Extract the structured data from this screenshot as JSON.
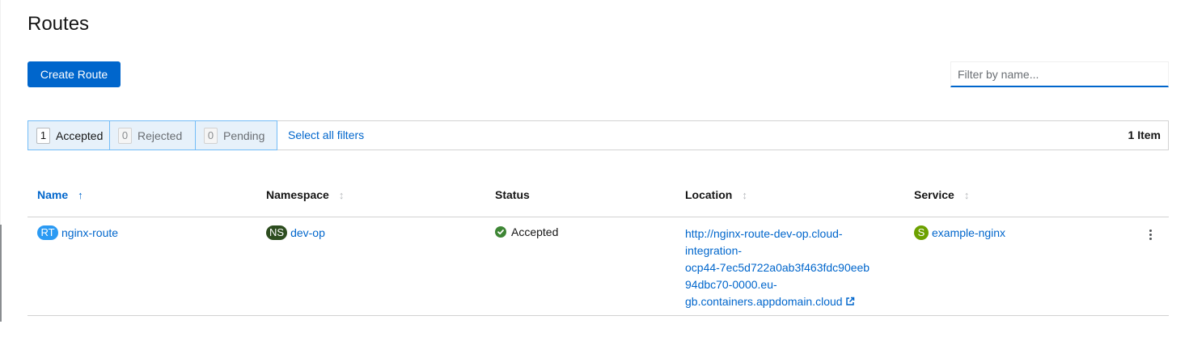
{
  "page": {
    "title": "Routes",
    "create_button_label": "Create Route"
  },
  "search": {
    "placeholder": "Filter by name...",
    "value": ""
  },
  "filters": {
    "row_filters": [
      {
        "count": "1",
        "label": "Accepted",
        "active": true
      },
      {
        "count": "0",
        "label": "Rejected",
        "active": false
      },
      {
        "count": "0",
        "label": "Pending",
        "active": false
      }
    ],
    "select_all_label": "Select all filters",
    "item_count_label": "1 Item"
  },
  "table": {
    "columns": [
      {
        "label": "Name",
        "sorted": true,
        "sort_icon": "arrow-up-icon"
      },
      {
        "label": "Namespace",
        "sorted": false,
        "sort_icon": "sort-icon"
      },
      {
        "label": "Status",
        "sorted": false
      },
      {
        "label": "Location",
        "sorted": false,
        "sort_icon": "sort-icon"
      },
      {
        "label": "Service",
        "sorted": false,
        "sort_icon": "sort-icon"
      }
    ],
    "rows": [
      {
        "name": {
          "badge": "RT",
          "value": "nginx-route"
        },
        "namespace": {
          "badge": "NS",
          "value": "dev-op"
        },
        "status": {
          "icon": "check-circle-icon",
          "value": "Accepted"
        },
        "location": {
          "lines": [
            "http://nginx-route-dev-op.cloud-",
            "integration-",
            "ocp44-7ec5d722a0ab3f463fdc90eeb",
            "94dbc70-0000.eu-",
            "gb.containers.appdomain.cloud"
          ],
          "icon": "external-link-icon"
        },
        "service": {
          "badge": "S",
          "value": "example-nginx"
        }
      }
    ]
  },
  "colors": {
    "primary": "#0066cc",
    "rt_badge": "#2b9af3",
    "ns_badge": "#2d4d1f",
    "s_badge": "#6ca100",
    "success": "#3e8635"
  }
}
